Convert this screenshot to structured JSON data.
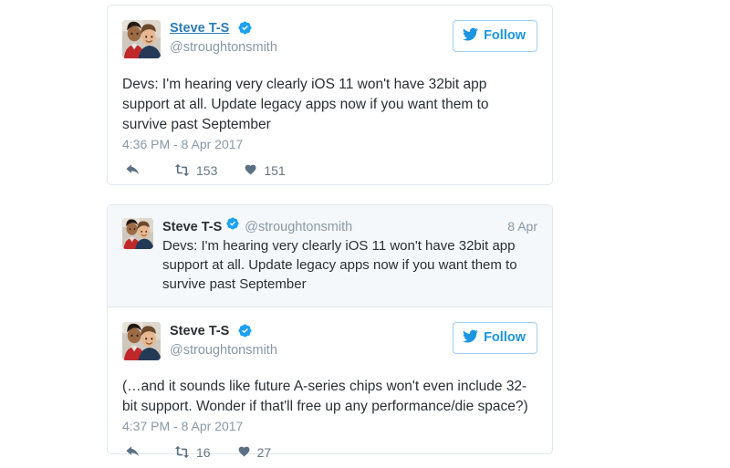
{
  "page": {
    "background": "#ffffff",
    "card_border_color": "#e1e8ed",
    "parent_background": "#f5f8fa",
    "link_color": "#2b7bb9",
    "twitter_blue": "#1da1f2",
    "follow_text_color": "#1b95e0",
    "muted_color": "#8899a6",
    "text_color": "#292f33"
  },
  "cards": [
    {
      "id": "tweet-card-1",
      "author": {
        "display_name": "Steve T-S",
        "handle": "@stroughtonsmith",
        "verified": true,
        "name_is_hovered_link": true,
        "avatar_alt": "two-people-photo"
      },
      "follow_button": {
        "label": "Follow",
        "icon": "twitter-bird-icon"
      },
      "text": "Devs: I'm hearing very clearly iOS 11 won't have 32bit app support at all. Update legacy apps now if you want them to survive past September",
      "timestamp": "4:36 PM - 8 Apr 2017",
      "actions": {
        "reply_icon": "reply-arrow-icon",
        "reply_count": "",
        "retweet_icon": "retweet-icon",
        "retweet_count": "153",
        "like_icon": "heart-icon",
        "like_count": "151"
      }
    },
    {
      "id": "tweet-card-2",
      "parent_tweet": {
        "display_name": "Steve T-S",
        "handle": "@stroughtonsmith",
        "verified": true,
        "date": "8 Apr",
        "text": "Devs: I'm hearing very clearly iOS 11 won't have 32bit app support at all. Update legacy apps now if you want them to survive past September",
        "avatar_alt": "two-people-photo"
      },
      "author": {
        "display_name": "Steve T-S",
        "handle": "@stroughtonsmith",
        "verified": true,
        "name_is_hovered_link": false,
        "avatar_alt": "two-people-photo"
      },
      "follow_button": {
        "label": "Follow",
        "icon": "twitter-bird-icon"
      },
      "text": "(…and it sounds like future A-series chips won't even include 32-bit support. Wonder if that'll free up any performance/die space?)",
      "timestamp": "4:37 PM - 8 Apr 2017",
      "actions": {
        "reply_icon": "reply-arrow-icon",
        "reply_count": "",
        "retweet_icon": "retweet-icon",
        "retweet_count": "16",
        "like_icon": "heart-icon",
        "like_count": "27"
      }
    }
  ]
}
